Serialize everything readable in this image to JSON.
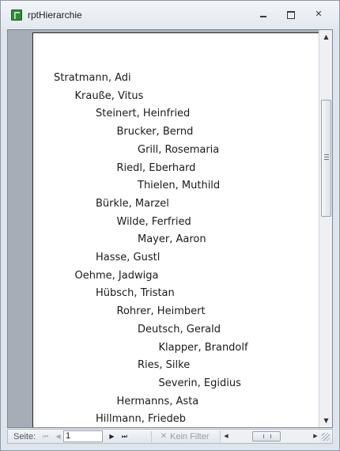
{
  "window": {
    "title": "rptHierarchie",
    "icon": "report-icon",
    "controls": {
      "minimize": "minimize-icon",
      "maximize": "maximize-icon",
      "close": "✕"
    }
  },
  "report": {
    "rows": [
      {
        "name": "Stratmann, Adi",
        "level": 0
      },
      {
        "name": "Krauße, Vitus",
        "level": 1
      },
      {
        "name": "Steinert, Heinfried",
        "level": 2
      },
      {
        "name": "Brucker, Bernd",
        "level": 3
      },
      {
        "name": "Grill, Rosemaria",
        "level": 4
      },
      {
        "name": "Riedl, Eberhard",
        "level": 3
      },
      {
        "name": "Thielen, Muthild",
        "level": 4
      },
      {
        "name": "Bürkle, Marzel",
        "level": 2
      },
      {
        "name": "Wilde, Ferfried",
        "level": 3
      },
      {
        "name": "Mayer, Aaron",
        "level": 4
      },
      {
        "name": "Hasse, Gustl",
        "level": 2
      },
      {
        "name": "Oehme, Jadwiga",
        "level": 1
      },
      {
        "name": "Hübsch, Tristan",
        "level": 2
      },
      {
        "name": "Rohrer, Heimbert",
        "level": 3
      },
      {
        "name": "Deutsch, Gerald",
        "level": 4
      },
      {
        "name": "Klapper, Brandolf",
        "level": 5
      },
      {
        "name": "Ries, Silke",
        "level": 4
      },
      {
        "name": "Severin, Egidius",
        "level": 5
      },
      {
        "name": "Hermanns, Asta",
        "level": 3
      },
      {
        "name": "Hillmann, Friedeb",
        "level": 2
      }
    ]
  },
  "navigation": {
    "page_label": "Seite:",
    "page_value": "1",
    "first": "⏮",
    "prev": "◀",
    "next": "▶",
    "last": "⏭",
    "filter_icon": "✕",
    "filter_label": "Kein Filter"
  },
  "scrollbar": {
    "up": "▲",
    "down": "▼",
    "left": "◀",
    "right": "▶"
  }
}
